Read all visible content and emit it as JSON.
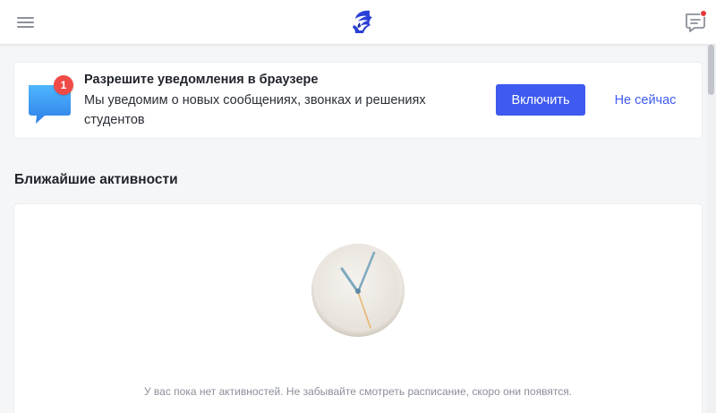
{
  "header": {
    "menu_icon": "hamburger-menu-icon",
    "logo_icon": "spartan-helmet-logo",
    "chat_icon": "chat-bubble-icon",
    "chat_has_unread": true
  },
  "notification": {
    "badge_count": "1",
    "title": "Разрешите уведомления в браузере",
    "body": "Мы уведомим о новых сообщениях, звонках и решениях студентов",
    "enable_label": "Включить",
    "later_label": "Не сейчас"
  },
  "activities": {
    "title": "Ближайшие активности",
    "empty_message": "У вас пока нет активностей. Не забывайте смотреть расписание, скоро они появятся."
  },
  "colors": {
    "accent": "#3e5af0",
    "badge": "#f04b47",
    "background": "#f5f6f8"
  }
}
